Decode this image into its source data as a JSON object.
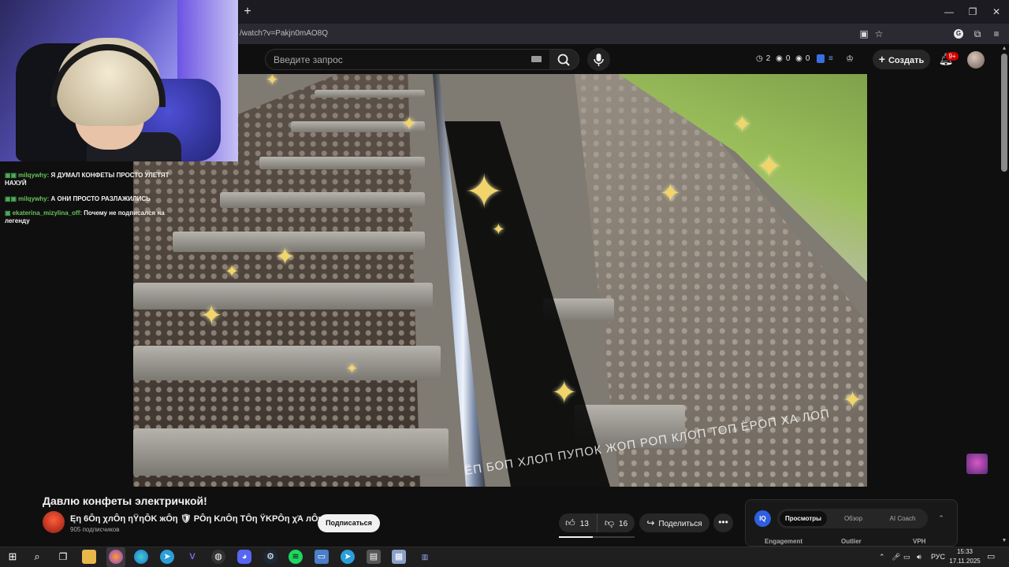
{
  "browser": {
    "url": "/watch?v=Pakjn0mAO8Q",
    "new_tab_icon": "plus-icon",
    "ext_letter": "G"
  },
  "masthead": {
    "search_placeholder": "Введите запрос",
    "stats": [
      "2",
      "0",
      "0"
    ],
    "create_label": "Создать",
    "notifications_badge": "9+"
  },
  "chat": {
    "messages": [
      {
        "user": "milqywhy",
        "text": "А ОНИ ПРОСТО РАЗЛАЖИЛИСЬ"
      },
      {
        "user": "ekaterina_mizylina_off",
        "text": "Почему не подписался на легенду"
      }
    ],
    "partial": {
      "user": "milqywhy:",
      "text": "Я ДУМАЛ КОНФЕТЫ ПРОСТО УЛЕТЯТ НАХУЙ"
    }
  },
  "video": {
    "caption": "ЁП БОП ХЛОП ПУПОК ЖОП РОП КЛОП ТОП ЁРОП ХА ЛОП"
  },
  "info": {
    "title": "Давлю конфеты электричкой!",
    "channel_name": "Ęη 6Ôη χлÔη ηŸηÔK жÔη 🛡 ΡÔη ΚлÔη ΤÔη ŸΚΡÔη χΆ лÔη",
    "subscribers": "905 подписчиков",
    "subscribe_label": "Подписаться",
    "likes": "13",
    "dislikes": "16",
    "like_ratio": 0.45,
    "share_label": "Поделиться"
  },
  "vidiq": {
    "logo": "IQ",
    "tabs": [
      "Просмотры",
      "Обзор",
      "AI Coach"
    ],
    "columns": [
      "Engagement",
      "Outlier",
      "VPH"
    ]
  },
  "taskbar": {
    "language": "РУС",
    "time": "15:33",
    "date": "17.11.2025"
  }
}
